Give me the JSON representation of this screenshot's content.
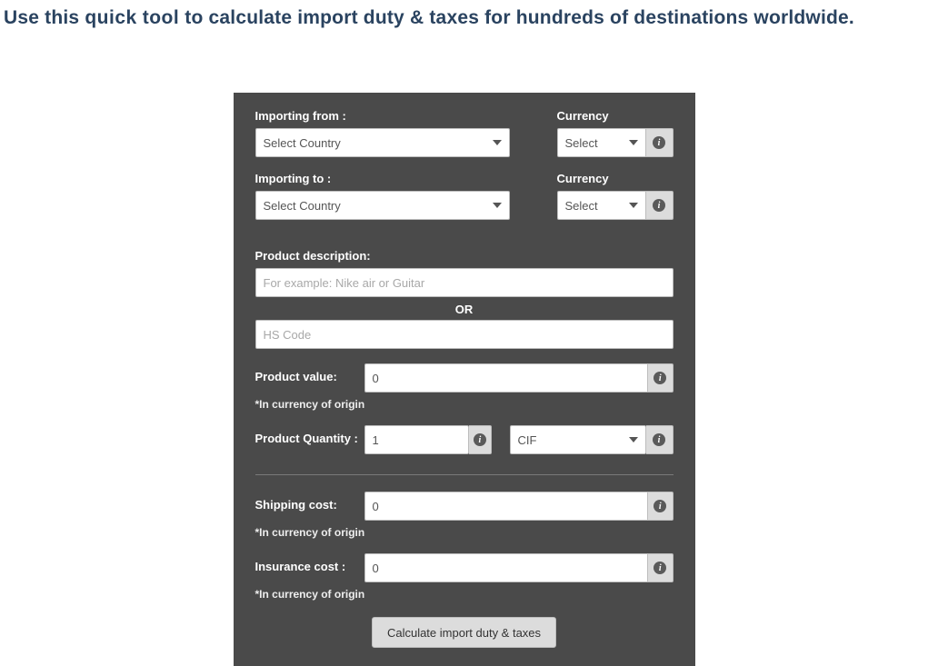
{
  "heading": {
    "pre": "Use this ",
    "w1": "quick",
    "sp1": "  ",
    "w2": "tool",
    "sp2": "  ",
    "post": "to calculate import duty & taxes for hundreds of destinations worldwide."
  },
  "form": {
    "importing_from": {
      "label": "Importing from :",
      "placeholder": "Select Country"
    },
    "importing_to": {
      "label": "Importing to :",
      "placeholder": "Select Country"
    },
    "currency_from": {
      "label": "Currency",
      "placeholder": "Select"
    },
    "currency_to": {
      "label": "Currency",
      "placeholder": "Select"
    },
    "product_description": {
      "label": "Product description:",
      "placeholder": "For example: Nike air or Guitar"
    },
    "or_text": "OR",
    "hs_code": {
      "placeholder": "HS Code"
    },
    "product_value": {
      "label": "Product value:",
      "value": "0",
      "note": "*In currency of origin"
    },
    "product_quantity": {
      "label": "Product Quantity :",
      "value": "1"
    },
    "incoterm": {
      "value": "CIF"
    },
    "shipping_cost": {
      "label": "Shipping cost:",
      "value": "0",
      "note": "*In currency of origin"
    },
    "insurance_cost": {
      "label": "Insurance cost :",
      "value": "0",
      "note": "*In currency of origin"
    },
    "submit_label": "Calculate import duty & taxes",
    "info_glyph": "i"
  }
}
